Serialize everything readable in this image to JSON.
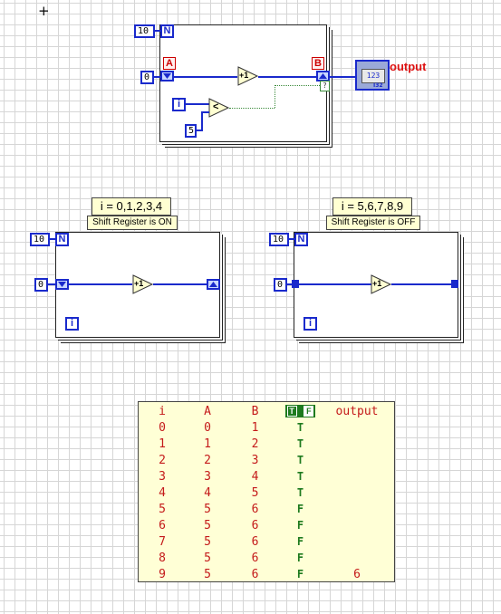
{
  "cursor": "+",
  "top_diagram": {
    "n_value": "10",
    "n_terminal": "N",
    "init_value": "0",
    "shift_left_label": "A",
    "shift_right_label": "B",
    "increment_label": "+1",
    "compare_label": "<",
    "i_terminal": "i",
    "compare_constant": "5",
    "indicator_value": "123",
    "indicator_type": "I32",
    "output_label": "output",
    "stop_mark": "?"
  },
  "left_diagram": {
    "caption": "i = 0,1,2,3,4",
    "sub_caption": "Shift Register is ON",
    "n_value": "10",
    "n_terminal": "N",
    "init_value": "0",
    "increment_label": "+1",
    "i_terminal": "i"
  },
  "right_diagram": {
    "caption": "i = 5,6,7,8,9",
    "sub_caption": "Shift Register is OFF",
    "n_value": "10",
    "n_terminal": "N",
    "init_value": "0",
    "increment_label": "+1",
    "i_terminal": "i"
  },
  "results_table": {
    "headers": [
      "i",
      "A",
      "B",
      "TF",
      "output"
    ],
    "tf_t": "T",
    "tf_f": "F",
    "rows": [
      [
        "0",
        "0",
        "1",
        "T",
        ""
      ],
      [
        "1",
        "1",
        "2",
        "T",
        ""
      ],
      [
        "2",
        "2",
        "3",
        "T",
        ""
      ],
      [
        "3",
        "3",
        "4",
        "T",
        ""
      ],
      [
        "4",
        "4",
        "5",
        "T",
        ""
      ],
      [
        "5",
        "5",
        "6",
        "F",
        ""
      ],
      [
        "6",
        "5",
        "6",
        "F",
        ""
      ],
      [
        "7",
        "5",
        "6",
        "F",
        ""
      ],
      [
        "8",
        "5",
        "6",
        "F",
        ""
      ],
      [
        "9",
        "5",
        "6",
        "F",
        "6"
      ]
    ]
  },
  "colors": {
    "wire_blue": "#1a2acc",
    "bool_green": "#1e7a1e",
    "table_red": "#c41a1a",
    "label_bg": "#ffffd2",
    "accent_red": "#dd1111"
  }
}
